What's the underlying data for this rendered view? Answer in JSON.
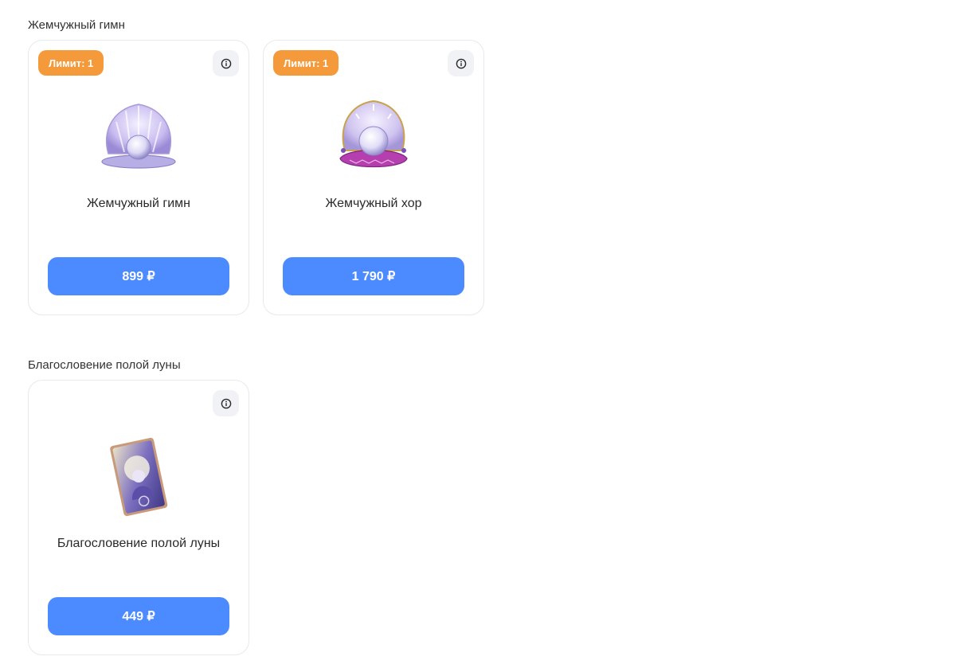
{
  "sections": [
    {
      "title": "Жемчужный гимн",
      "items": [
        {
          "limit": "Лимит: 1",
          "name": "Жемчужный гимн",
          "price": "899 ₽",
          "image_icon": "pearl-shell-icon"
        },
        {
          "limit": "Лимит: 1",
          "name": "Жемчужный хор",
          "price": "1 790 ₽",
          "image_icon": "pearl-shell-cushion-icon"
        }
      ]
    },
    {
      "title": "Благословение полой луны",
      "items": [
        {
          "name": "Благословение полой луны",
          "price": "449 ₽",
          "image_icon": "moon-card-icon"
        }
      ]
    }
  ],
  "colors": {
    "accent": "#4c8bff",
    "badge": "#f59a3a",
    "card_border": "#e7e9ee",
    "info_bg": "#f1f2f5"
  }
}
